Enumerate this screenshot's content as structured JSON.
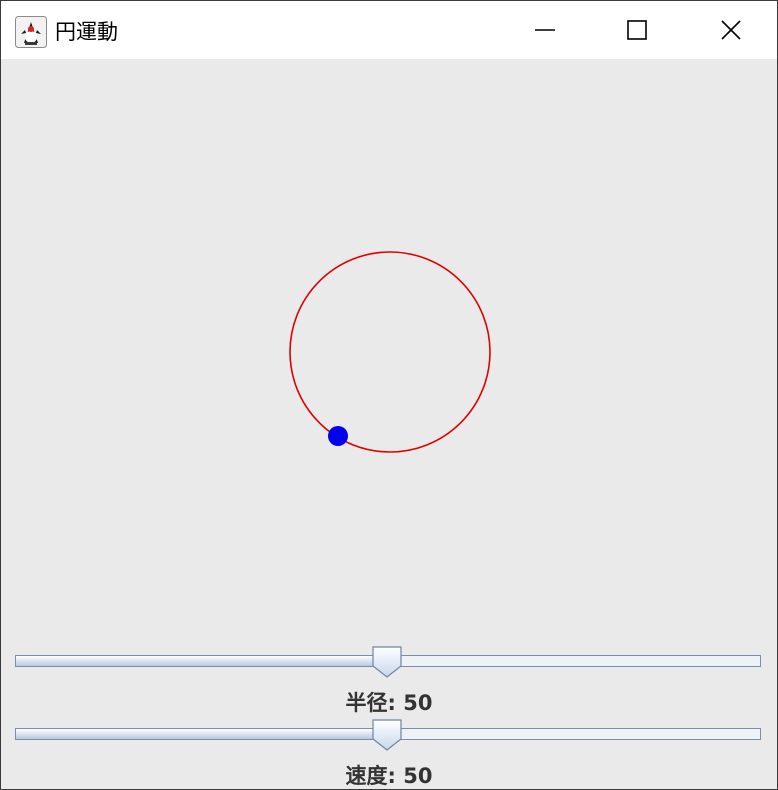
{
  "window": {
    "title": "円運動",
    "icon": "java-duke-icon",
    "controls": [
      "minimize-icon",
      "maximize-icon",
      "close-icon"
    ]
  },
  "animation": {
    "circle_color": "#e00000",
    "ball_color": "#0000ee",
    "background": "#eaeaea"
  },
  "sliders": [
    {
      "id": "radius",
      "label_prefix": "半径:",
      "value": 50,
      "min": 0,
      "max": 100,
      "label": "半径: 50"
    },
    {
      "id": "speed",
      "label_prefix": "速度:",
      "value": 50,
      "min": 0,
      "max": 100,
      "label": "速度: 50"
    }
  ]
}
